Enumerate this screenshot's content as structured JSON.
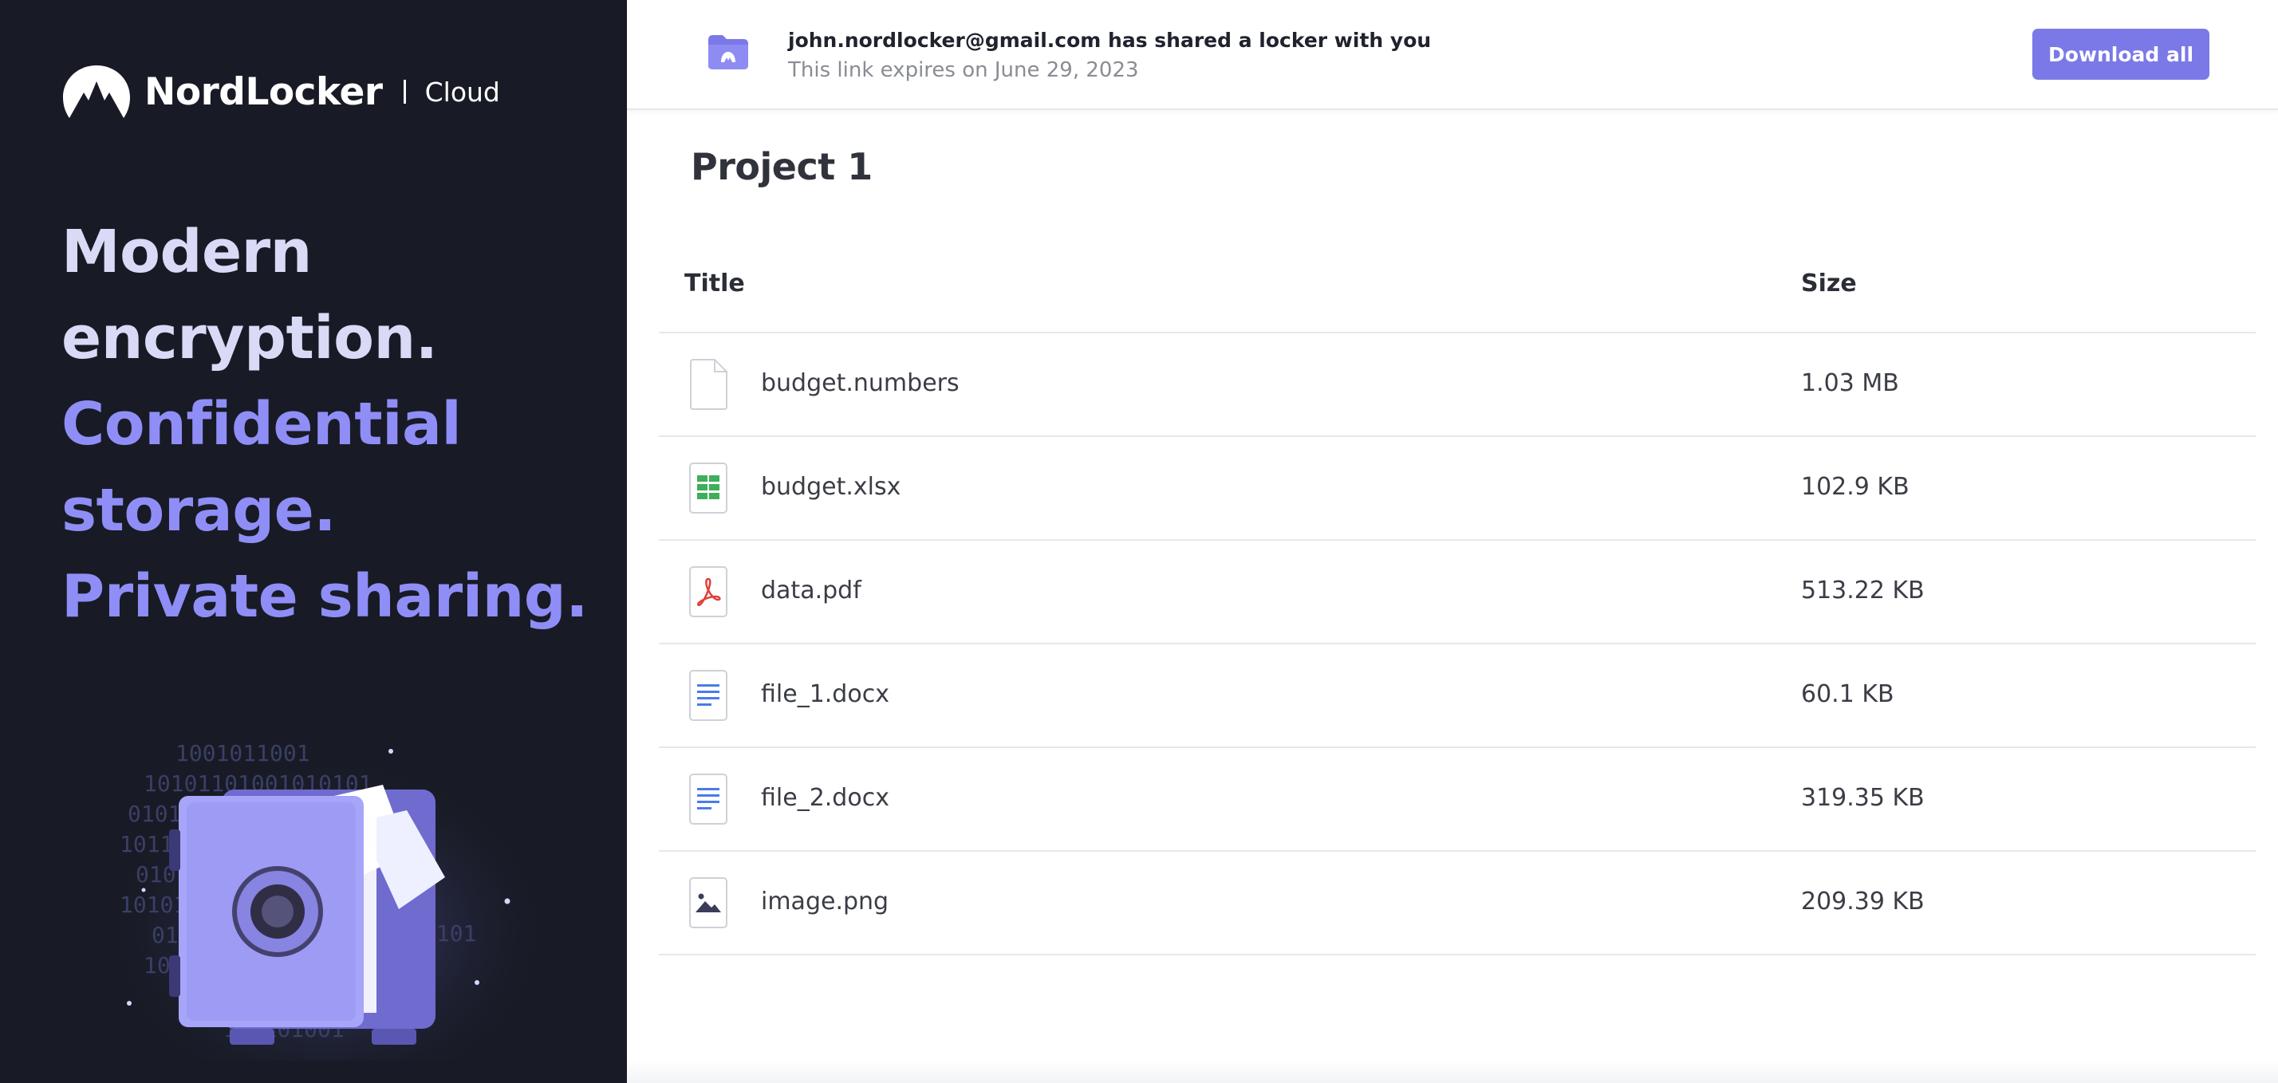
{
  "brand": {
    "name": "NordLocker",
    "product": "Cloud"
  },
  "headline": {
    "line1": "Modern",
    "line2": "encryption.",
    "line3": "Confidential",
    "line4": "storage.",
    "line5": "Private sharing."
  },
  "share": {
    "title": "john.nordlocker@gmail.com has shared a locker with you",
    "expiry": "This link expires on June 29, 2023",
    "download_label": "Download all"
  },
  "locker": {
    "title": "Project 1"
  },
  "table": {
    "col_title": "Title",
    "col_size": "Size",
    "files": [
      {
        "name": "budget.numbers",
        "size": "1.03 MB",
        "icon": "generic-file-icon"
      },
      {
        "name": "budget.xlsx",
        "size": "102.9 KB",
        "icon": "spreadsheet-file-icon"
      },
      {
        "name": "data.pdf",
        "size": "513.22 KB",
        "icon": "pdf-file-icon"
      },
      {
        "name": "file_1.docx",
        "size": "60.1 KB",
        "icon": "document-file-icon"
      },
      {
        "name": "file_2.docx",
        "size": "319.35 KB",
        "icon": "document-file-icon"
      },
      {
        "name": "image.png",
        "size": "209.39 KB",
        "icon": "image-file-icon"
      }
    ]
  },
  "colors": {
    "sidebar_bg": "#181b25",
    "accent": "#7b79e8",
    "headline_light": "#d8daf6",
    "headline_purple": "#8f8ef7"
  }
}
